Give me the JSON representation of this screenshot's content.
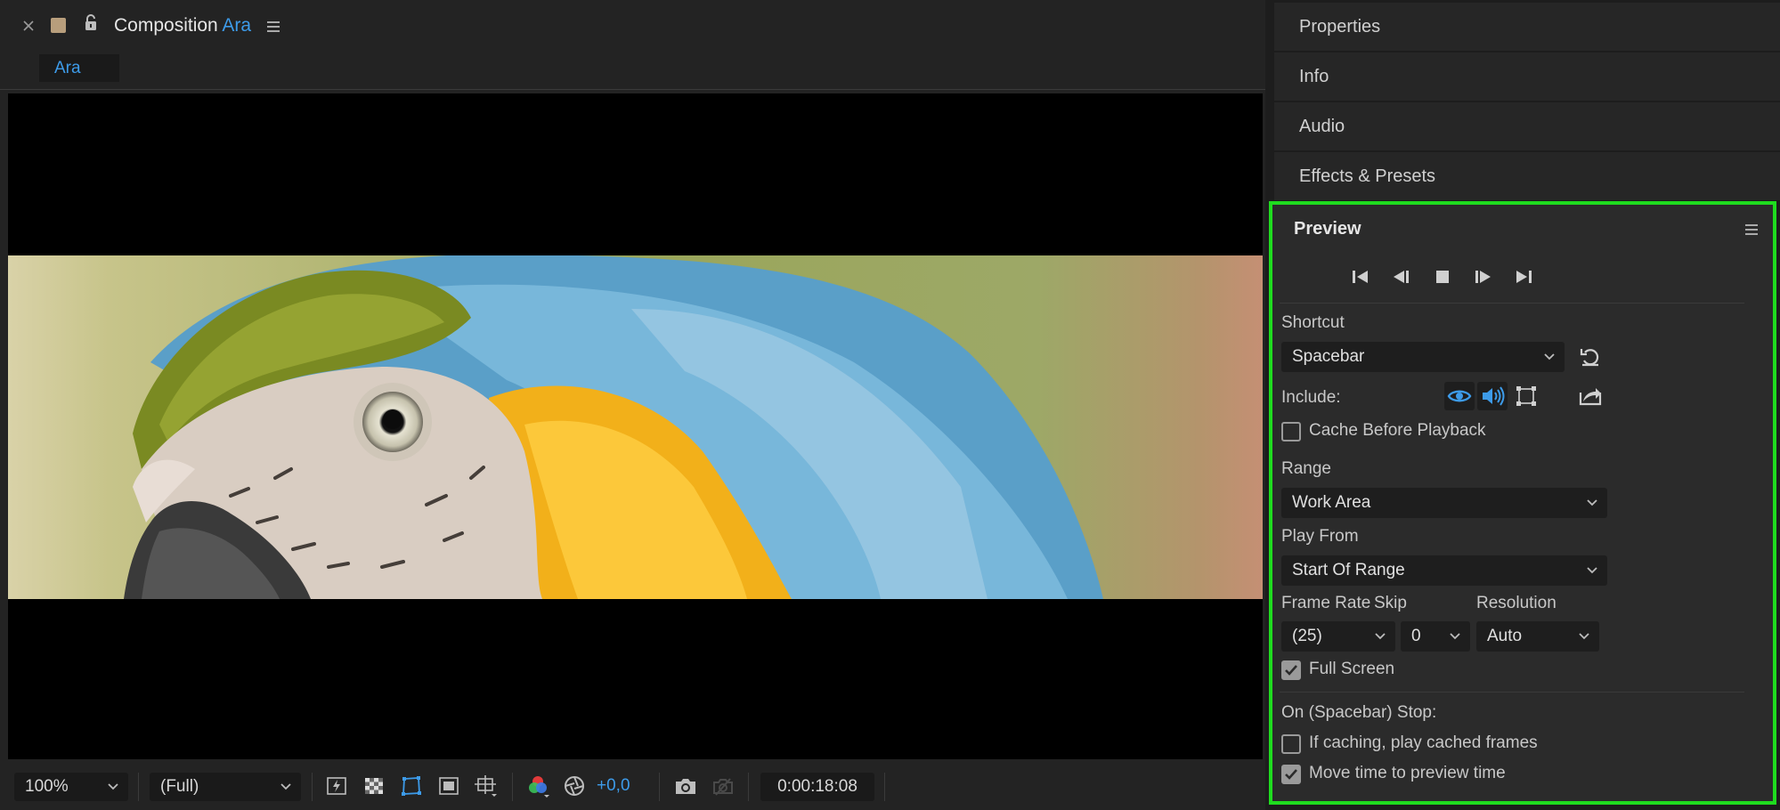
{
  "composition": {
    "title_prefix": "Composition",
    "title_name": "Ara",
    "tab_label": "Ara",
    "icons": [
      "close-icon",
      "color-swatch-icon",
      "lock-icon",
      "panel-menu-icon"
    ]
  },
  "viewer_toolbar": {
    "zoom": "100%",
    "resolution": "(Full)",
    "exposure": "+0,0",
    "current_time": "0:00:18:08"
  },
  "panels": {
    "properties": "Properties",
    "info": "Info",
    "audio": "Audio",
    "effects": "Effects & Presets"
  },
  "preview": {
    "title": "Preview",
    "shortcut_label": "Shortcut",
    "shortcut_value": "Spacebar",
    "include_label": "Include:",
    "cache_label": "Cache Before Playback",
    "cache_checked": false,
    "range_label": "Range",
    "range_value": "Work Area",
    "play_from_label": "Play From",
    "play_from_value": "Start Of Range",
    "frame_rate_label": "Frame Rate",
    "frame_rate_value": "(25)",
    "skip_label": "Skip",
    "skip_value": "0",
    "resolution_label": "Resolution",
    "resolution_value": "Auto",
    "full_screen_label": "Full Screen",
    "full_screen_checked": true,
    "on_stop_label": "On (Spacebar) Stop:",
    "if_caching_label": "If caching, play cached frames",
    "if_caching_checked": false,
    "move_time_label": "Move time to preview time",
    "move_time_checked": true
  },
  "colors": {
    "accent_blue": "#3d9be9",
    "highlight_green": "#1fdc1f"
  }
}
